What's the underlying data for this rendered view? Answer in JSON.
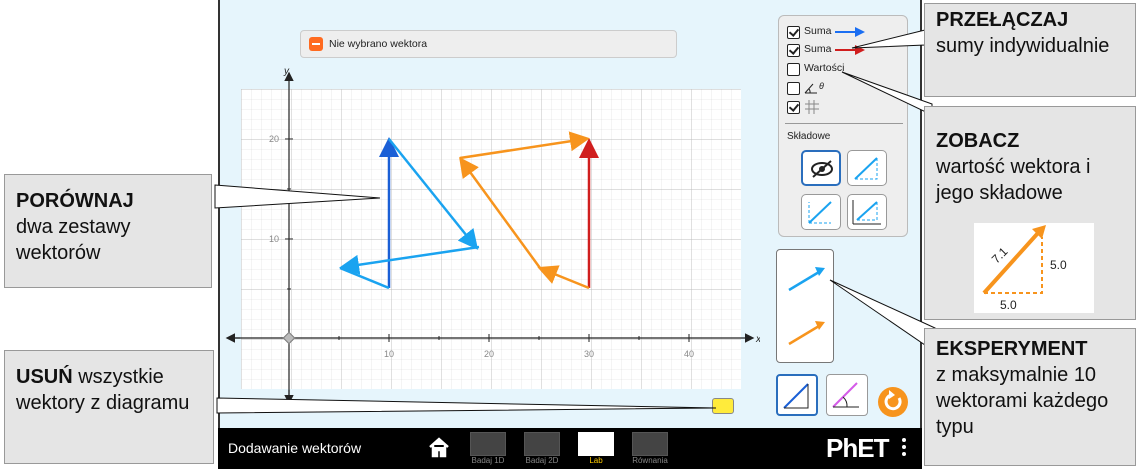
{
  "status": {
    "text": "Nie wybrano wektora"
  },
  "panel": {
    "rows": [
      {
        "label": "Suma",
        "checked": true,
        "color": "#1a6ef2"
      },
      {
        "label": "Suma",
        "checked": true,
        "color": "#d01e1e"
      },
      {
        "label": "Wartości",
        "checked": false
      },
      {
        "label": "θ",
        "checked": false
      },
      {
        "label": "",
        "checked": true
      }
    ],
    "components_label": "Składowe"
  },
  "axes": {
    "x_label": "x",
    "y_label": "y",
    "x_ticks": [
      "10",
      "20",
      "30",
      "40"
    ],
    "y_ticks": [
      "20",
      "10"
    ]
  },
  "navbar": {
    "title": "Dodawanie wektorów",
    "screens": [
      {
        "label": "Badaj 1D",
        "active": false
      },
      {
        "label": "Badaj 2D",
        "active": false
      },
      {
        "label": "Lab",
        "active": true
      },
      {
        "label": "Równania",
        "active": false
      }
    ],
    "brand": "PhET"
  },
  "callouts": {
    "compare": {
      "bold": "PORÓWNAJ",
      "rest": "dwa zestawy wektorów"
    },
    "clear": {
      "bold": "USUŃ",
      "rest": " wszystkie wektory z diagramu"
    },
    "toggle": {
      "bold": "PRZEŁĄCZAJ",
      "rest": "sumy indywidualnie"
    },
    "see": {
      "bold": "ZOBACZ",
      "rest": "wartość wektora i jego składowe"
    },
    "experiment": {
      "bold": "EKSPERYMENT",
      "rest": "z maksymalnie 10 wektorami każdego typu"
    }
  },
  "example": {
    "magnitude": "7.1",
    "comp_x": "5.0",
    "comp_y": "5.0"
  },
  "colors": {
    "blue_set": "#1aa3f0",
    "blue_sum": "#1a5fd6",
    "orange_set": "#f7941d",
    "red_sum": "#d01e1e"
  }
}
